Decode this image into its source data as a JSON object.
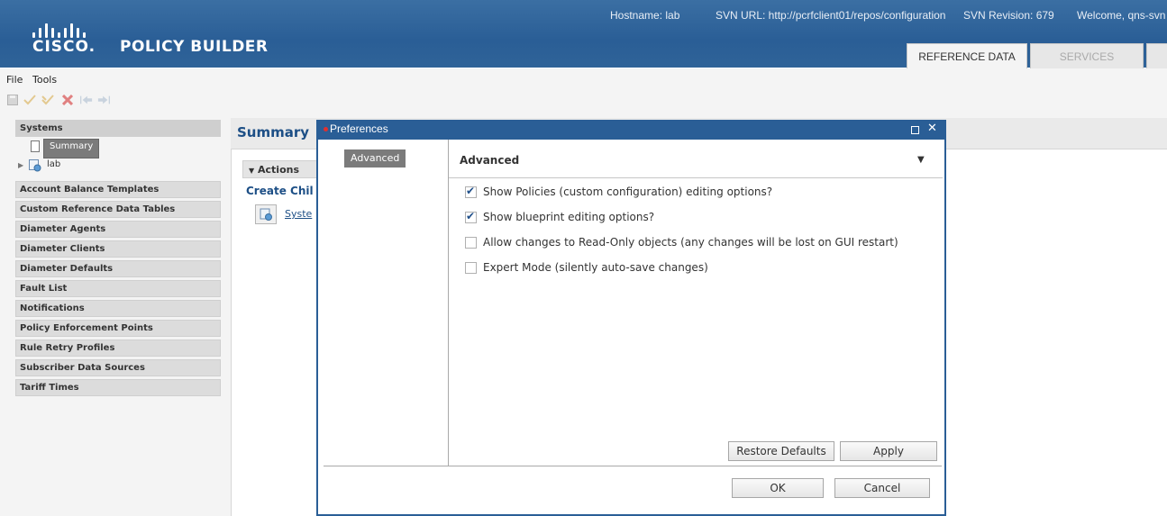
{
  "header": {
    "brand": "CISCO.",
    "product": "POLICY BUILDER",
    "hostname": "Hostname: lab",
    "svn_url": "SVN URL: http://pcrfclient01/repos/configuration",
    "svn_revision": "SVN Revision: 679",
    "welcome": "Welcome, qns-svn",
    "tabs": [
      {
        "label": "REFERENCE DATA",
        "active": true
      },
      {
        "label": "SERVICES",
        "active": false
      }
    ]
  },
  "menu": {
    "file": "File",
    "tools": "Tools"
  },
  "toolbar": {
    "icons": [
      "save-icon",
      "check-icon",
      "check-all-icon",
      "delete-icon",
      "back-icon",
      "forward-icon"
    ]
  },
  "sidebar": {
    "systems_header": "Systems",
    "summary_item": "Summary",
    "lab_item": "lab",
    "sections": [
      "Account Balance Templates",
      "Custom Reference Data Tables",
      "Diameter Agents",
      "Diameter Clients",
      "Diameter Defaults",
      "Fault List",
      "Notifications",
      "Policy Enforcement Points",
      "Rule Retry Profiles",
      "Subscriber Data Sources",
      "Tariff Times"
    ]
  },
  "main": {
    "title": "Summary",
    "actions_label": "Actions",
    "create_child_label": "Create Chil",
    "system_link": "Syste"
  },
  "dialog": {
    "title": "Preferences",
    "left_nav_item": "Advanced",
    "section_title": "Advanced",
    "options": [
      {
        "label": "Show Policies (custom configuration) editing options?",
        "checked": true
      },
      {
        "label": "Show blueprint editing options?",
        "checked": true
      },
      {
        "label": "Allow changes to Read-Only objects (any changes will be lost on GUI restart)",
        "checked": false
      },
      {
        "label": "Expert Mode (silently auto-save changes)",
        "checked": false
      }
    ],
    "restore_defaults": "Restore Defaults",
    "apply": "Apply",
    "ok": "OK",
    "cancel": "Cancel"
  },
  "colors": {
    "header_blue": "#2a5e96",
    "link_blue": "#1d4f86",
    "selected_gray": "#7b7b7b"
  }
}
